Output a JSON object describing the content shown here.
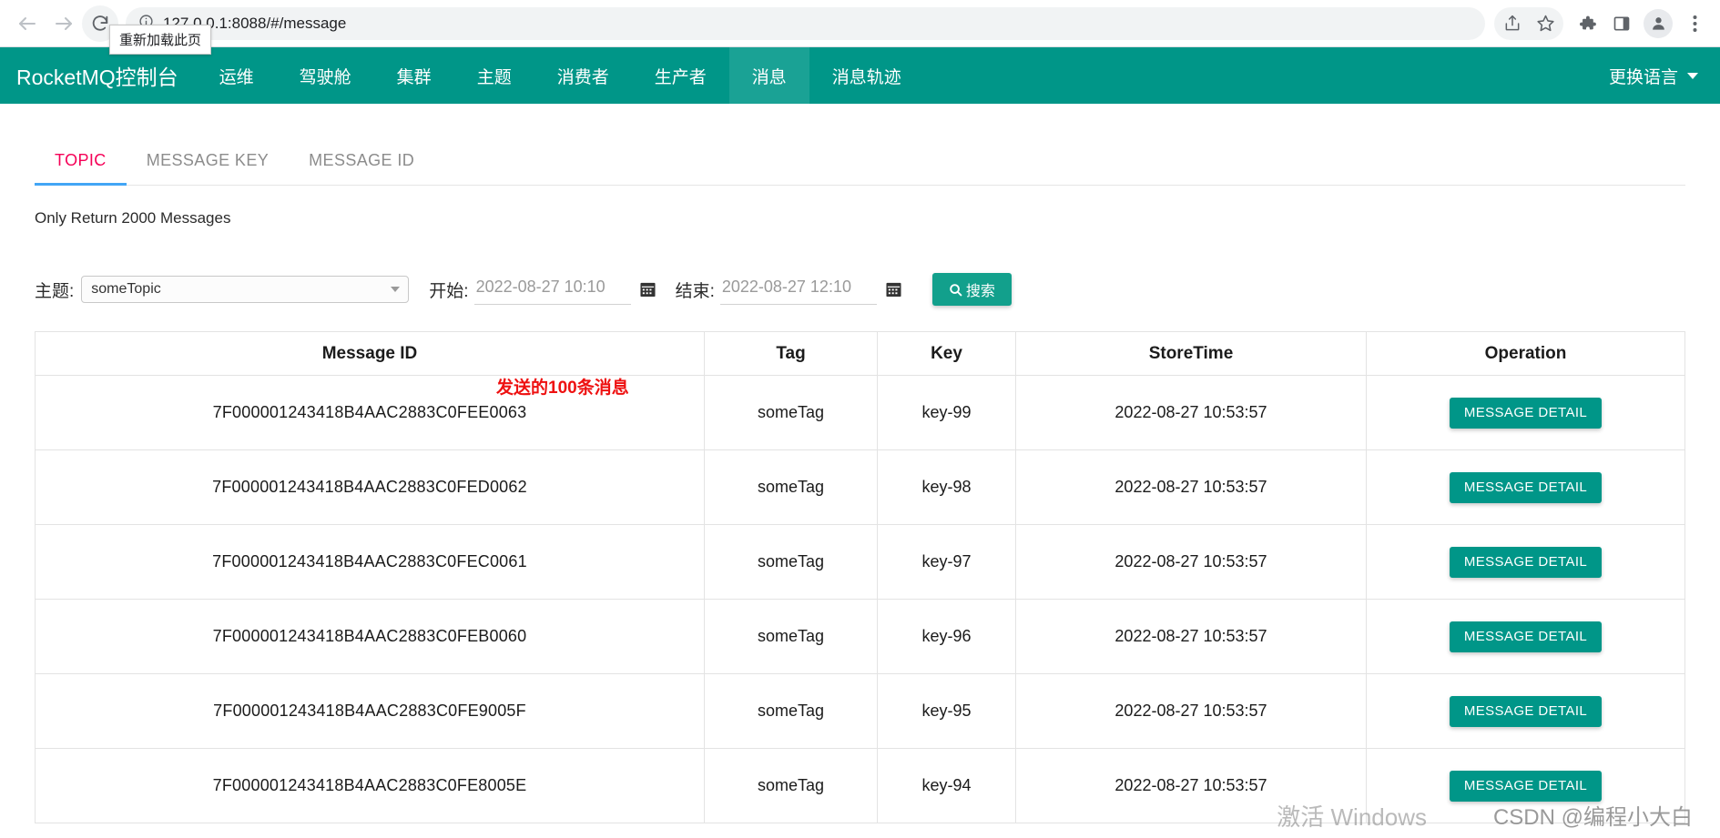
{
  "browser": {
    "back_label": "Back",
    "forward_label": "Forward",
    "reload_label": "Reload",
    "reload_tooltip": "重新加载此页",
    "url": "127.0.0.1:8088/#/message",
    "site_info_icon": "info-circle-icon",
    "actions": [
      {
        "name": "share-icon",
        "label": "Share"
      },
      {
        "name": "bookmark-star-icon",
        "label": "Bookmark"
      },
      {
        "name": "extensions-puzzle-icon",
        "label": "Extensions"
      },
      {
        "name": "side-panel-icon",
        "label": "Side panel"
      },
      {
        "name": "profile-avatar-icon",
        "label": "Profile"
      },
      {
        "name": "chrome-menu-icon",
        "label": "Customize and control"
      }
    ]
  },
  "navbar": {
    "brand": "RocketMQ控制台",
    "accent_color": "#009688",
    "active_color": "#1aa295",
    "items": [
      {
        "label": "运维",
        "active": false
      },
      {
        "label": "驾驶舱",
        "active": false
      },
      {
        "label": "集群",
        "active": false
      },
      {
        "label": "主题",
        "active": false
      },
      {
        "label": "消费者",
        "active": false
      },
      {
        "label": "生产者",
        "active": false
      },
      {
        "label": "消息",
        "active": true
      },
      {
        "label": "消息轨迹",
        "active": false
      }
    ],
    "language_switch": "更换语言"
  },
  "tabs": [
    {
      "label": "TOPIC",
      "active": true
    },
    {
      "label": "MESSAGE KEY",
      "active": false
    },
    {
      "label": "MESSAGE ID",
      "active": false
    }
  ],
  "tab_colors": {
    "active_text": "#f50057",
    "active_underline": "#42a5f5",
    "inactive_text": "#8c8c8c"
  },
  "notice": "Only Return 2000 Messages",
  "annotation": {
    "text": "发送的100条消息",
    "color": "#ee1111"
  },
  "search": {
    "topic_label": "主题:",
    "topic_value": "someTopic",
    "begin_label": "开始:",
    "begin_value": "2022-08-27 10:10",
    "end_label": "结束:",
    "end_value": "2022-08-27 12:10",
    "calendar_icon": "calendar-icon",
    "search_button": "搜索",
    "search_icon": "search-icon",
    "button_color": "#12a08c"
  },
  "table": {
    "columns": [
      "Message ID",
      "Tag",
      "Key",
      "StoreTime",
      "Operation"
    ],
    "detail_button_label": "MESSAGE DETAIL",
    "rows": [
      {
        "message_id": "7F000001243418B4AAC2883C0FEE0063",
        "tag": "someTag",
        "key": "key-99",
        "store_time": "2022-08-27 10:53:57"
      },
      {
        "message_id": "7F000001243418B4AAC2883C0FED0062",
        "tag": "someTag",
        "key": "key-98",
        "store_time": "2022-08-27 10:53:57"
      },
      {
        "message_id": "7F000001243418B4AAC2883C0FEC0061",
        "tag": "someTag",
        "key": "key-97",
        "store_time": "2022-08-27 10:53:57"
      },
      {
        "message_id": "7F000001243418B4AAC2883C0FEB0060",
        "tag": "someTag",
        "key": "key-96",
        "store_time": "2022-08-27 10:53:57"
      },
      {
        "message_id": "7F000001243418B4AAC2883C0FE9005F",
        "tag": "someTag",
        "key": "key-95",
        "store_time": "2022-08-27 10:53:57"
      },
      {
        "message_id": "7F000001243418B4AAC2883C0FE8005E",
        "tag": "someTag",
        "key": "key-94",
        "store_time": "2022-08-27 10:53:57"
      }
    ]
  },
  "watermarks": {
    "windows": "激活 Windows",
    "csdn": "CSDN @编程小大白"
  }
}
